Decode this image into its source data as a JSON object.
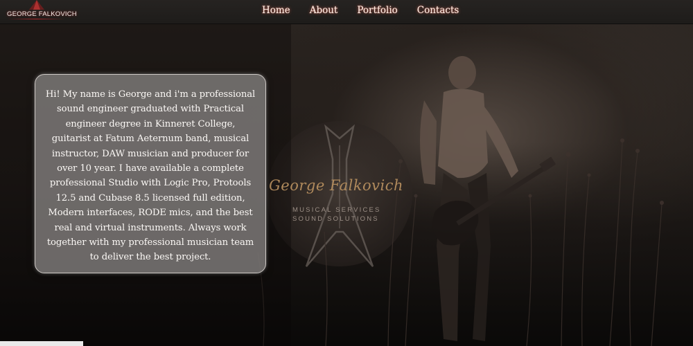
{
  "brand": {
    "name": "GEORGE FALKOVICH"
  },
  "nav": {
    "items": [
      {
        "label": "Home"
      },
      {
        "label": "About"
      },
      {
        "label": "Portfolio"
      },
      {
        "label": "Contacts"
      }
    ]
  },
  "hero": {
    "bio": "Hi! My name is George and i'm a professional sound engineer graduated with Practical engineer degree in Kinneret College, guitarist at Fatum Aeternum band, musical instructor, DAW musician and producer for over 10 year. I have available a complete professional Studio with Logic Pro, Protools 12.5 and Cubase 8.5 licensed full edition, Modern interfaces, RODE mics, and the best real and virtual instruments. Always work together with my professional musician team to deliver the best project.",
    "logo": {
      "title": "George Falkovich",
      "subtitle_line1": "MUSICAL SERVICES",
      "subtitle_line2": "SOUND SOLUTIONS"
    }
  },
  "colors": {
    "nav_bar": "#232120",
    "nav_text": "#f7ece4",
    "nav_glow": "#ff7864",
    "logo_gold": "#b08a5c",
    "card_bg": "#807d7b",
    "brand_accent": "#b3262a"
  },
  "icons": {
    "brand_mark": "stage-light-icon",
    "logo_emblem": "flying-v-guitar-emblem"
  }
}
